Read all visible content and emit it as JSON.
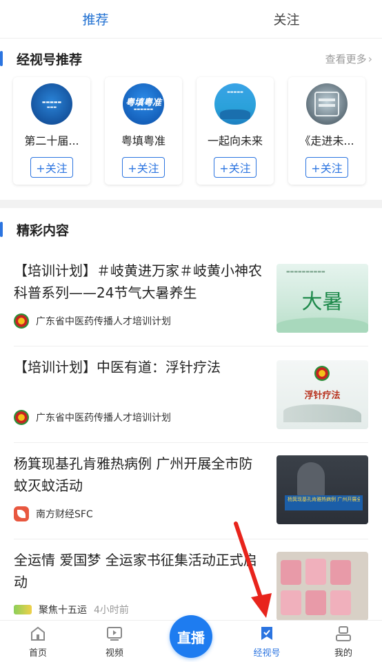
{
  "top_tabs": [
    {
      "label": "推荐",
      "active": true
    },
    {
      "label": "关注",
      "active": false
    }
  ],
  "channels_section": {
    "title": "经视号推荐",
    "more_label": "查看更多"
  },
  "channels": [
    {
      "name": "第二十届...",
      "follow_label": "+关注"
    },
    {
      "name": "粤填粤准",
      "follow_label": "+关注",
      "avatar_text": "粤填粤准"
    },
    {
      "name": "一起向未来",
      "follow_label": "+关注"
    },
    {
      "name": "《走进未...",
      "follow_label": "+关注"
    }
  ],
  "content_section": {
    "title": "精彩内容"
  },
  "feed": [
    {
      "title": "【培训计划】＃岐黄进万家＃岐黄小神农科普系列——24节气大暑养生",
      "source": "广东省中医药传播人才培训计划",
      "time": "",
      "thumb_text": "大暑"
    },
    {
      "title": "【培训计划】中医有道：浮针疗法",
      "source": "广东省中医药传播人才培训计划",
      "time": "",
      "thumb_text": "浮针疗法"
    },
    {
      "title": "杨箕现基孔肯雅热病例 广州开展全市防蚊灭蚊活动",
      "source": "南方财经SFC",
      "time": "",
      "thumb_text": "杨箕现基孔肯雅热病例 广州开展全市防蚊灭蚊活动"
    },
    {
      "title": "全运情 爱国梦 全运家书征集活动正式启动",
      "source": "聚焦十五运",
      "time": "4小时前",
      "thumb_text": ""
    }
  ],
  "bottom_nav": {
    "home": "首页",
    "video": "视频",
    "live": "直播",
    "jingshihao": "经视号",
    "mine": "我的"
  },
  "colors": {
    "accent": "#2b74e0",
    "live_button": "#1e7cf0",
    "annotation_arrow": "#e8241c"
  }
}
